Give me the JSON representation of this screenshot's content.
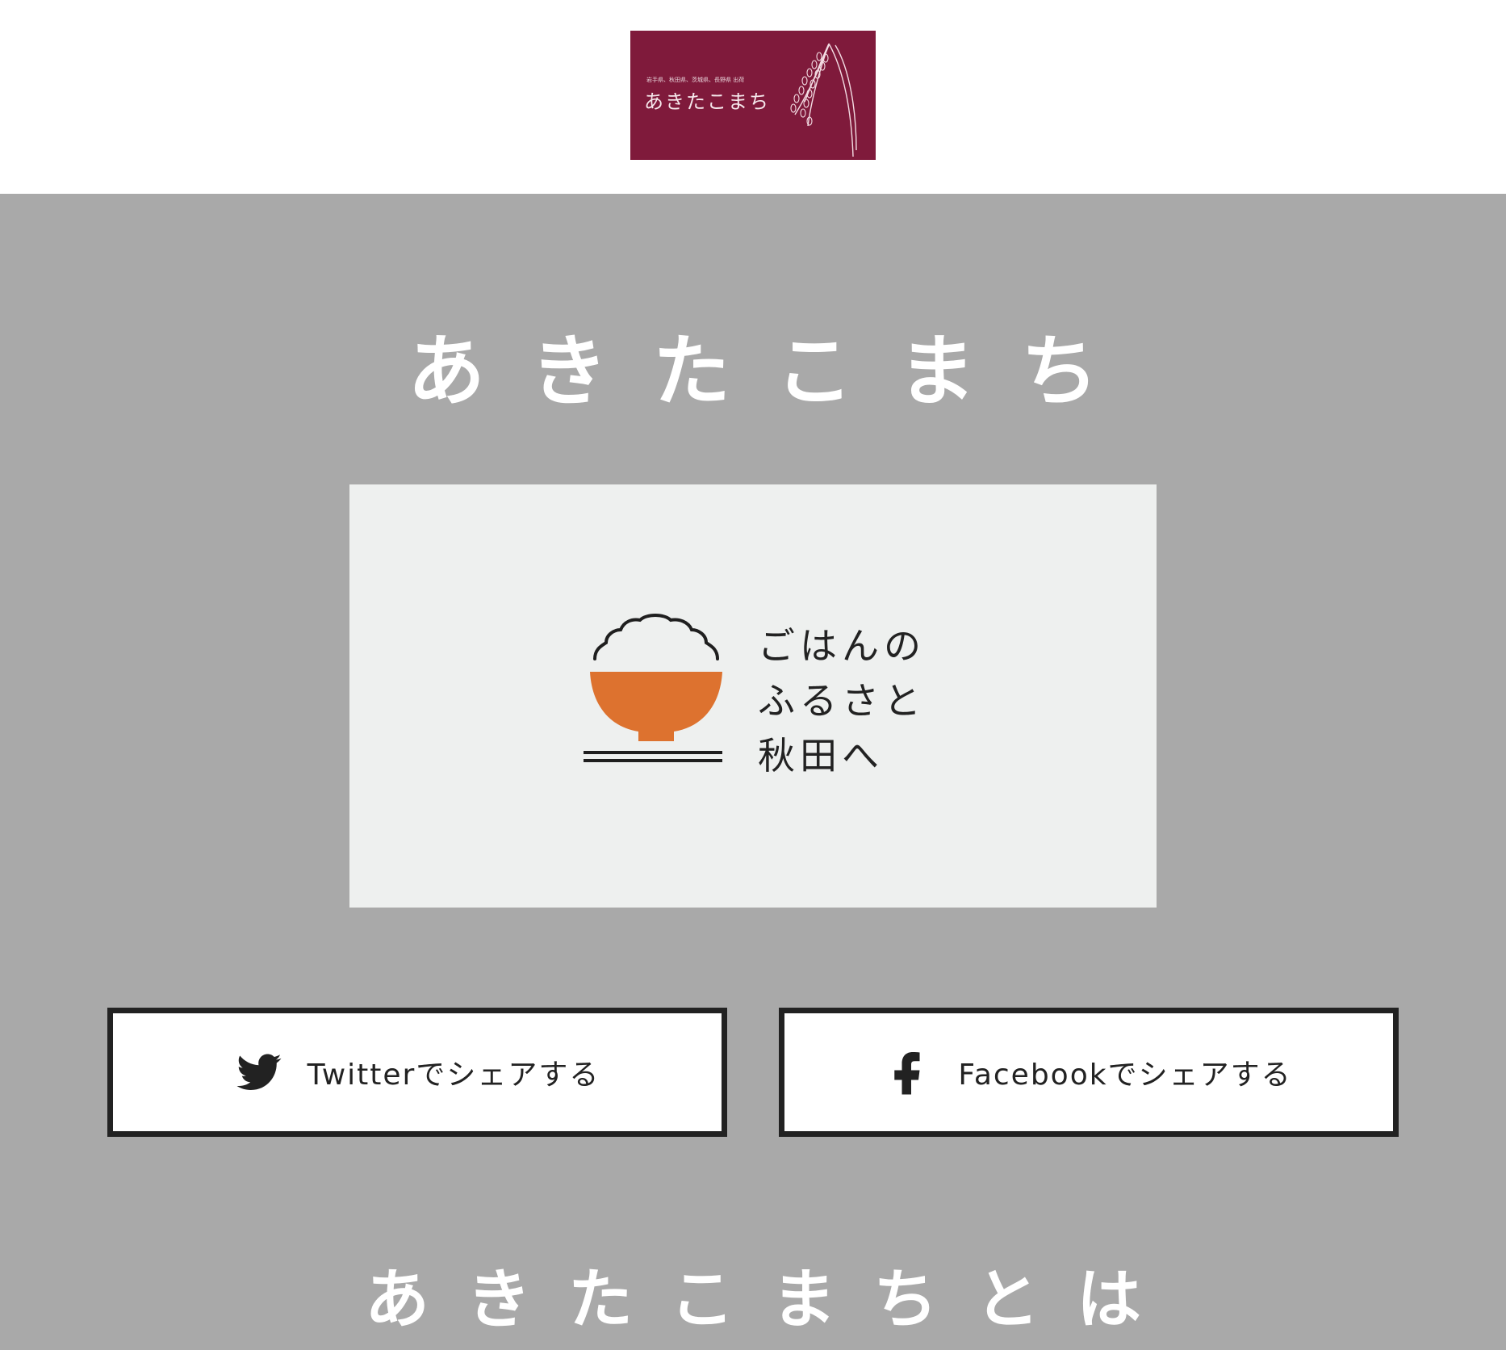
{
  "header": {
    "logo": {
      "subtitle": "岩手県、秋田県、茨城県、長野県 出荷",
      "name": "あきたこまち"
    }
  },
  "main": {
    "title": "あきたこまち",
    "hero": {
      "catch_lines": [
        "ごはんの",
        "ふるさと",
        "秋田へ"
      ]
    },
    "share": {
      "twitter_label": "Twitterでシェアする",
      "facebook_label": "Facebookでシェアする"
    },
    "section_title": "あきたこまちとは"
  },
  "colors": {
    "brand": "#7f1a3b",
    "background": "#a9a9a9",
    "bowl": "#dd722f",
    "text_dark": "#222222"
  },
  "icons": {
    "twitter": "twitter-bird-icon",
    "facebook": "facebook-f-icon",
    "rice": "rice-plant-icon",
    "bowl": "rice-bowl-icon"
  }
}
